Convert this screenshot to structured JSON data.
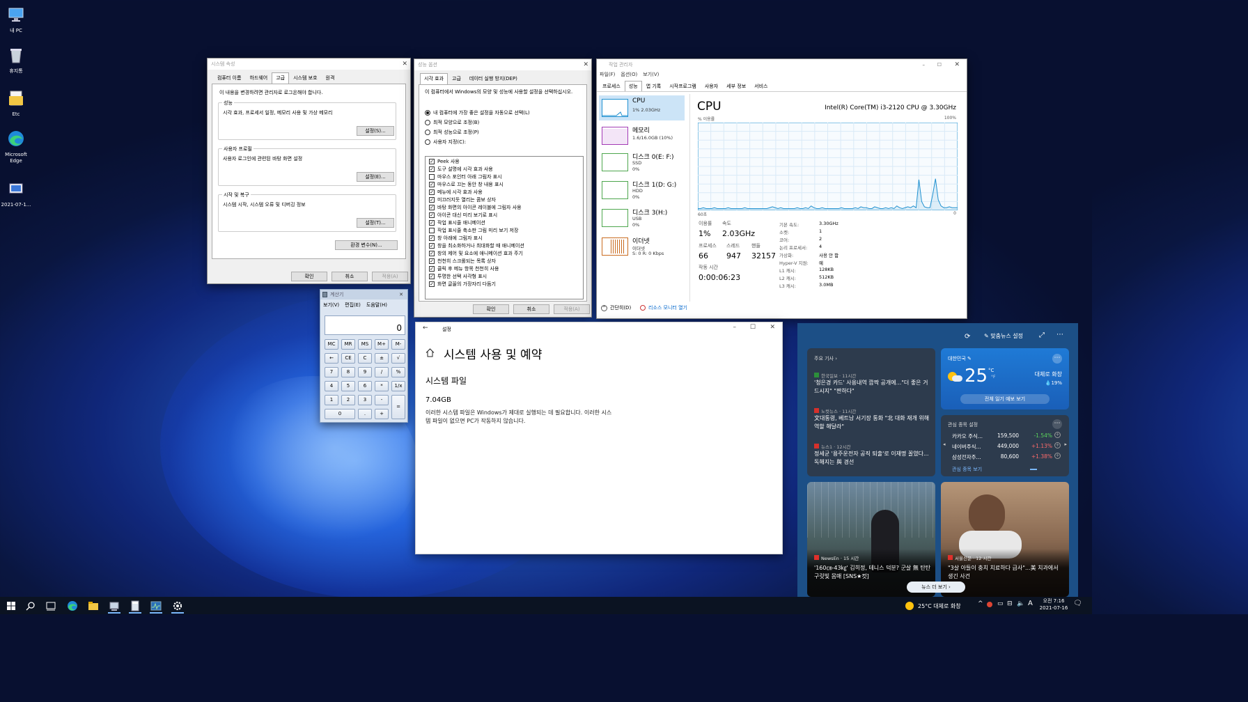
{
  "desktop": {
    "icons": [
      {
        "label": "내 PC"
      },
      {
        "label": "휴지통"
      },
      {
        "label": "Etc"
      },
      {
        "label": "Microsoft Edge"
      },
      {
        "label": "2021-07-1..."
      }
    ]
  },
  "sysprops": {
    "title": "시스템 속성",
    "tabs": [
      "컴퓨터 이름",
      "하드웨어",
      "고급",
      "시스템 보호",
      "원격"
    ],
    "note": "이 내용을 변경하려면 관리자로 로그온해야 합니다.",
    "perf": {
      "label": "성능",
      "text": "시각 효과, 프로세서 일정, 메모리 사용 및 가상 메모리",
      "btn": "설정(S)..."
    },
    "profile": {
      "label": "사용자 프로필",
      "text": "사용자 로그인에 관련된 바탕 화면 설정",
      "btn": "설정(E)..."
    },
    "startup": {
      "label": "시작 및 복구",
      "text": "시스템 시작, 시스템 오류 및 디버깅 정보",
      "btn": "설정(T)..."
    },
    "env_btn": "환경 변수(N)...",
    "ok": "확인",
    "cancel": "취소",
    "apply": "적용(A)"
  },
  "perfopts": {
    "title": "성능 옵션",
    "tabs": [
      "시각 효과",
      "고급",
      "데이터 실행 방지(DEP)"
    ],
    "desc": "이 컴퓨터에서 Windows의 모양 및 성능에 사용할 설정을 선택하십시오.",
    "radios": [
      "내 컴퓨터에 가장 좋은 설정을 자동으로 선택(L)",
      "최적 모양으로 조정(B)",
      "최적 성능으로 조정(P)",
      "사용자 지정(C):"
    ],
    "checks": [
      {
        "t": "Peek 사용",
        "on": true
      },
      {
        "t": "도구 설명에 시각 효과 사용",
        "on": true
      },
      {
        "t": "마우스 포인터 아래 그림자 표시",
        "on": false
      },
      {
        "t": "마우스로 끄는 동안 창 내용 표시",
        "on": true
      },
      {
        "t": "메뉴에 시각 효과 사용",
        "on": true
      },
      {
        "t": "미끄러지듯 열리는 콤보 상자",
        "on": true
      },
      {
        "t": "바탕 화면의 아이콘 레이블에 그림자 사용",
        "on": true
      },
      {
        "t": "아이콘 대신 미리 보기로 표시",
        "on": true
      },
      {
        "t": "작업 표시줄 애니메이션",
        "on": true
      },
      {
        "t": "작업 표시줄 축소판 그림 미리 보기 저장",
        "on": false
      },
      {
        "t": "창 아래에 그림자 표시",
        "on": true
      },
      {
        "t": "창을 최소화하거나 최대화할 때 애니메이션",
        "on": true
      },
      {
        "t": "창의 제어 및 요소에 애니메이션 효과 주기",
        "on": true
      },
      {
        "t": "천천히 스크롤되는 목록 상자",
        "on": true
      },
      {
        "t": "클릭 후 메뉴 항목 천천히 사용",
        "on": true
      },
      {
        "t": "투명한 선택 사각형 표시",
        "on": true
      },
      {
        "t": "화면 글꼴의 가장자리 다듬기",
        "on": true
      }
    ],
    "ok": "확인",
    "cancel": "취소",
    "apply": "적용(A)"
  },
  "taskmgr": {
    "title": "작업 관리자",
    "menu": [
      "파일(F)",
      "옵션(O)",
      "보기(V)"
    ],
    "tabs": [
      "프로세스",
      "성능",
      "앱 기록",
      "시작프로그램",
      "사용자",
      "세부 정보",
      "서비스"
    ],
    "rows": [
      {
        "label": "CPU",
        "sub1": "1% 2.03GHz",
        "sub2": ""
      },
      {
        "label": "메모리",
        "sub1": "1.6/16.0GB (10%)",
        "sub2": ""
      },
      {
        "label": "디스크 0(E: F:)",
        "sub1": "SSD",
        "sub2": "0%"
      },
      {
        "label": "디스크 1(D: G:)",
        "sub1": "HDD",
        "sub2": "0%"
      },
      {
        "label": "디스크 3(H:)",
        "sub1": "USB",
        "sub2": "0%"
      },
      {
        "label": "이더넷",
        "sub1": "이더넷",
        "sub2": "S: 0 R: 0 Kbps"
      }
    ],
    "heading": "CPU",
    "model": "Intel(R) Core(TM) i3-2120 CPU @ 3.30GHz",
    "usage_label": "% 이용률",
    "pct100": "100%",
    "time_label": "60초",
    "zero": "0",
    "util_label": "이용률",
    "speed_label": "속도",
    "util": "1%",
    "speed": "2.03GHz",
    "proc_label": "프로세스",
    "thread_label": "스레드",
    "handle_label": "핸들",
    "proc": "66",
    "thread": "947",
    "handle": "32157",
    "uptime_label": "작동 시간",
    "uptime": "0:00:06:23",
    "details": [
      {
        "k": "기본 속도:",
        "v": "3.30GHz"
      },
      {
        "k": "소켓:",
        "v": "1"
      },
      {
        "k": "코어:",
        "v": "2"
      },
      {
        "k": "논리 프로세서:",
        "v": "4"
      },
      {
        "k": "가상화:",
        "v": "사용 안 함"
      },
      {
        "k": "Hyper-V 지원:",
        "v": "예"
      },
      {
        "k": "L1 캐시:",
        "v": "128KB"
      },
      {
        "k": "L2 캐시:",
        "v": "512KB"
      },
      {
        "k": "L3 캐시:",
        "v": "3.0MB"
      }
    ],
    "fewer": "간단히(D)",
    "resmon": "리소스 모니터 열기",
    "cpu_history": [
      2,
      2,
      3,
      2,
      2,
      2,
      3,
      2,
      2,
      2,
      2,
      3,
      2,
      2,
      2,
      2,
      2,
      3,
      2,
      2,
      2,
      2,
      2,
      2,
      2,
      2,
      3,
      4,
      3,
      2,
      3,
      2,
      2,
      2,
      2,
      2,
      3,
      2,
      2,
      3,
      2,
      5,
      3,
      2,
      2,
      3,
      2,
      2,
      2,
      2,
      2,
      2,
      3,
      2,
      2,
      2,
      2,
      3,
      2,
      4,
      3,
      3,
      2,
      2,
      4,
      3,
      2,
      2,
      3,
      2,
      3,
      2,
      5,
      3,
      2,
      3,
      4,
      3,
      5,
      3,
      35,
      10,
      4,
      3,
      3,
      18,
      36,
      12,
      5,
      3,
      3,
      4,
      3,
      3,
      3
    ]
  },
  "calc": {
    "title": "계산기",
    "menu": [
      "보기(V)",
      "편집(E)",
      "도움말(H)"
    ],
    "display": "0",
    "keys": [
      "MC",
      "MR",
      "MS",
      "M+",
      "M-",
      "←",
      "CE",
      "C",
      "±",
      "√",
      "7",
      "8",
      "9",
      "/",
      "%",
      "4",
      "5",
      "6",
      "*",
      "1/x",
      "1",
      "2",
      "3",
      "-",
      "=",
      "0",
      ".",
      "+"
    ]
  },
  "settings": {
    "title": "설정",
    "heading": "시스템 사용 및 예약",
    "section": "시스템 파일",
    "size": "7.04GB",
    "desc": "이러한 시스템 파일은 Windows가 제대로 실행되는 데 필요합니다. 이러한 시스템 파일이 없으면 PC가 작동하지 않습니다."
  },
  "news": {
    "header": "맞춤뉴스 설정",
    "top_label": "주요 기사",
    "articles": [
      {
        "src": "한국일보 · 11시간",
        "title": "'청은경 카드' 사용내역 깜짝 공개에...\"더 좋은 거 드시지\" \"짠하다\""
      },
      {
        "src": "노컷뉴스 · 11시간",
        "title": "文대통령, 베트남 서기장 통화 \"北 대화 재개 위해 역할 해달라\""
      },
      {
        "src": "뉴스1 · 12시간",
        "title": "정세균 '용주운전자 공직 퇴출'로 이재명 꼴였다...독해지는 與 경선"
      }
    ],
    "weather": {
      "loc": "대한민국",
      "temp": "25",
      "unit": "°C",
      "unitf": "°F",
      "cond": "대체로 화창",
      "rain": "19%",
      "btn": "전체 일기 예보 보기"
    },
    "stocks": {
      "label": "관심 종목 설정",
      "rows": [
        {
          "n": "카카오 주식...",
          "p": "159,500",
          "c": "-1.54%",
          "col": "#5cd65c"
        },
        {
          "n": "네이버주식...",
          "p": "449,000",
          "c": "+1.13%",
          "col": "#ff6b6b"
        },
        {
          "n": "삼성전자주...",
          "p": "80,600",
          "c": "+1.38%",
          "col": "#ff6b6b"
        }
      ],
      "more": "관심 종목 보기"
    },
    "photo1": {
      "src": "NewsEn · 15 시간",
      "title": "'160㎝-43㎏' 김히정, 테니스 덕분? 군살 無 탄탄 구릿빛 몸매 [SNS★컷]"
    },
    "photo2": {
      "src": "서울신문 · 12 시간",
      "title": "\"3살 아들이 충치 치료하다 급사\"...美 치과에서 생긴 사건"
    },
    "more_btn": "뉴스 더 보기"
  },
  "taskbar": {
    "weather": "25°C 대체로 화창",
    "ime": "A",
    "time": "오전 7:16",
    "date": "2021-07-16"
  }
}
